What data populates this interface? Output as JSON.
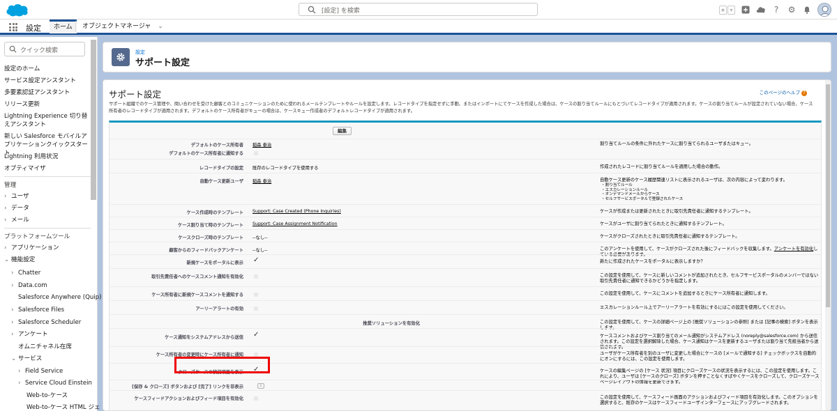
{
  "header": {
    "search_placeholder": "[設定] を検索"
  },
  "nav": {
    "app_name": "設定",
    "tabs": [
      {
        "label": "ホーム"
      },
      {
        "label": "オブジェクトマネージャ"
      }
    ]
  },
  "sidebar": {
    "quick_find_placeholder": "クイック検索",
    "items": [
      {
        "label": "設定のホーム"
      },
      {
        "label": "サービス設定アシスタント"
      },
      {
        "label": "多要素認証アシスタント"
      },
      {
        "label": "リリース更新"
      },
      {
        "label": "Lightning Experience 切り替えアシスタント"
      },
      {
        "label": "新しい Salesforce モバイルアプリケーションクイックスタート"
      },
      {
        "label": "Lightning 利用状況"
      },
      {
        "label": "オプティマイザ"
      }
    ],
    "section_admin": "管理",
    "admin_items": [
      {
        "label": "ユーザ"
      },
      {
        "label": "データ"
      },
      {
        "label": "メール"
      }
    ],
    "section_platform": "プラットフォームツール",
    "platform_items": [
      {
        "label": "アプリケーション"
      },
      {
        "label": "機能設定"
      }
    ],
    "feature_items": [
      {
        "label": "Chatter"
      },
      {
        "label": "Data.com"
      },
      {
        "label": "Salesforce Anywhere (Quip)"
      },
      {
        "label": "Salesforce Files"
      },
      {
        "label": "Salesforce Scheduler"
      },
      {
        "label": "アンケート"
      },
      {
        "label": "オムニチャネル在席"
      },
      {
        "label": "サービス"
      }
    ],
    "service_items": [
      {
        "label": "Field Service"
      },
      {
        "label": "Service Cloud Einstein"
      },
      {
        "label": "Web-to-ケース"
      },
      {
        "label": "Web-to-ケース HTML ジェ"
      }
    ]
  },
  "page_header": {
    "breadcrumb": "設定",
    "title": "サポート設定"
  },
  "content": {
    "title": "サポート設定",
    "help_link": "このページのヘルプ",
    "description": "サポート組織でのケース管理や、問い合わせを受けた顧客とのコミュニケーションのために使われるメールテンプレートやルールを設定します。レコードタイプを指定せずに手動、またはインポートにてケースを作成した場合は、ケースの割り当てルールにもとづいてレコードタイプが適用されます。ケースの割り当てルールが設定されていない場合、ケース所有者のレコードタイプが適用されます。デフォルトのケース所有者がキューの場合は、ケースキュー作成者のデフォルトレコードタイプが適用されます。",
    "edit_button": "編集",
    "rows": [
      {
        "label": "デフォルトのケース所有者",
        "value": "稲森 泰治",
        "help": "割り当てルールの条件に外れたケースに割り当てられるユーザまたはキュー。"
      },
      {
        "label": "デフォルトのケース所有者に通知する",
        "value": "",
        "help": ""
      },
      {
        "label": "レコードタイプの設定",
        "value": "既存のレコードタイプを使用する",
        "help": "作成されたレコードに割り当てルールを適用した場合の動作。"
      },
      {
        "label": "自動ケース更新ユーザ",
        "value": "稲森 泰治",
        "help": "自動ケース更新のケース履歴関連リストに表示されるユーザは、次の内容によって変わります。",
        "help_list": [
          "・割り当てルール",
          "・エスカレーションルール",
          "・オンデマンドメールからケース",
          "・セルフサービスポータルで登録されたケース"
        ]
      },
      {
        "label": "ケース作成時のテンプレート",
        "value": "Support: Case Created (Phone Inquiries)",
        "help": "ケースが作成または更新されたときに取引先責任者に通知するテンプレート。"
      },
      {
        "label": "ケース割り当て時のテンプレート",
        "value": "Support: Case Assignment Notification",
        "help": "ケースがユーザに割り当てられたときに通知するテンプレート。"
      },
      {
        "label": "ケースクローズ時のテンプレート",
        "value": "--なし--",
        "help": "ケースがクローズされたときに取引先責任者に通知するテンプレート。"
      },
      {
        "label": "顧客からのフィードバックアンケート",
        "value": "--なし--",
        "help_pre": "このアンケートを使用して、ケースがクローズされた後にフィードバックを収集します。",
        "help_link": "アンケートを有効化",
        "help_post": "している必要があります。"
      },
      {
        "label": "新規ケースをポータルに表示",
        "value": "",
        "help": "新たに作成されたケースをポータルに表示しますか？"
      },
      {
        "label": "取引先責任者へのケースコメント通知を有効化",
        "value": "",
        "help": "この設定を使用して、ケースに新しいコメントが追加されたとき、セルフサービスポータルのメンバーではない取引先責任者に通知できるかどうかを指定します。"
      },
      {
        "label": "ケース所有者に新規ケースコメントを通知する",
        "value": "",
        "help": "この設定を使用して、ケースにコメントを追加するときにケース所有者に通知します。"
      },
      {
        "label": "アーリーアラートの有効",
        "value": "",
        "help": "エスカレーションルール上でアーリーアラートを有効にするにはこの設定を使用してください。"
      },
      {
        "label": "推奨ソリューションを有効化",
        "value": "",
        "help": "この設定を使用して、ケースの詳細ページ上の [推奨ソリューションの参照] または [記事の検索] ボタンを表示します。"
      },
      {
        "label": "ケース通知をシステムアドレスから送信",
        "value": "",
        "help": "ケースコメントおよびケース割り当てのメール通知がシステムアドレス (noreply@salesforce.com) から送信されます。この設定を選択解除した場合、ケース通知はケースを更新するユーザまたは割り当て先担当者から送信されます。"
      },
      {
        "label": "ケース所有者の変更時にケース所有者に通知",
        "value": "",
        "help": "ユーザがケース所有者を別のユーザに変更した場合にケースの [メールで通知する] チェックボックスを自動的にオンにするには、この設定を使用します。"
      },
      {
        "label": "クローズケースの状況項目を表示",
        "value": "",
        "help": "ケースの編集ページの [ケース 状況] 項目にクローズケースの状況を表示するには、この設定を使用します。これにより、ユーザは [ケースのクローズ] ボタンを押すことなくすばやくケースをクローズして、クローズケースページレイアウトの情報を更新できます。"
      },
      {
        "label": "[保存 & クローズ] ボタンおよび [完了] リンクを非表示",
        "value": "",
        "help": ""
      },
      {
        "label": "ケースフィードアクションおよびフィード項目を有効化",
        "value": "",
        "help": "この設定を使用して、ケースフィード画面のアクションおよびフィード項目を有効化します。このオプションを選択すると、既存のケースはケースフィードユーザインターフェースにアップグレードされます。"
      }
    ]
  }
}
